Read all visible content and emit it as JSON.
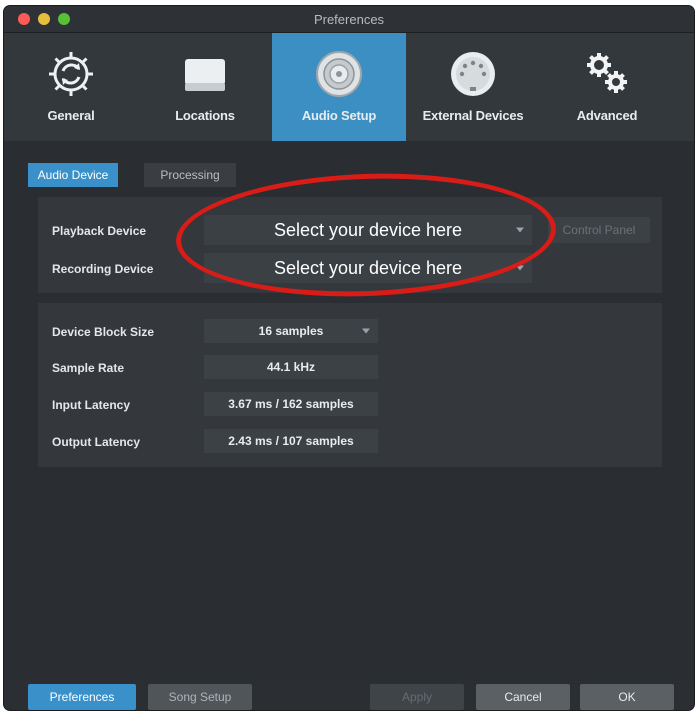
{
  "window": {
    "title": "Preferences"
  },
  "toolbar": {
    "items": [
      {
        "label": "General",
        "icon": "gear-refresh-icon"
      },
      {
        "label": "Locations",
        "icon": "drive-icon"
      },
      {
        "label": "Audio Setup",
        "icon": "speaker-icon",
        "active": true
      },
      {
        "label": "External Devices",
        "icon": "midi-connector-icon"
      },
      {
        "label": "Advanced",
        "icon": "gears-icon"
      }
    ]
  },
  "tabs": [
    {
      "label": "Audio Device",
      "active": true
    },
    {
      "label": "Processing",
      "active": false
    }
  ],
  "device": {
    "playback_label": "Playback Device",
    "playback_value": "Select your device here",
    "recording_label": "Recording Device",
    "recording_value": "Select your device here",
    "control_panel_label": "Control Panel"
  },
  "settings": {
    "block_size_label": "Device Block Size",
    "block_size_value": "16 samples",
    "sample_rate_label": "Sample Rate",
    "sample_rate_value": "44.1 kHz",
    "input_latency_label": "Input Latency",
    "input_latency_value": "3.67 ms / 162 samples",
    "output_latency_label": "Output Latency",
    "output_latency_value": "2.43 ms / 107 samples"
  },
  "footer": {
    "preferences_label": "Preferences",
    "song_setup_label": "Song Setup",
    "apply_label": "Apply",
    "cancel_label": "Cancel",
    "ok_label": "OK"
  },
  "colors": {
    "accent": "#3b8fc2",
    "annotation": "#d81c17",
    "background": "#2a2d31"
  }
}
